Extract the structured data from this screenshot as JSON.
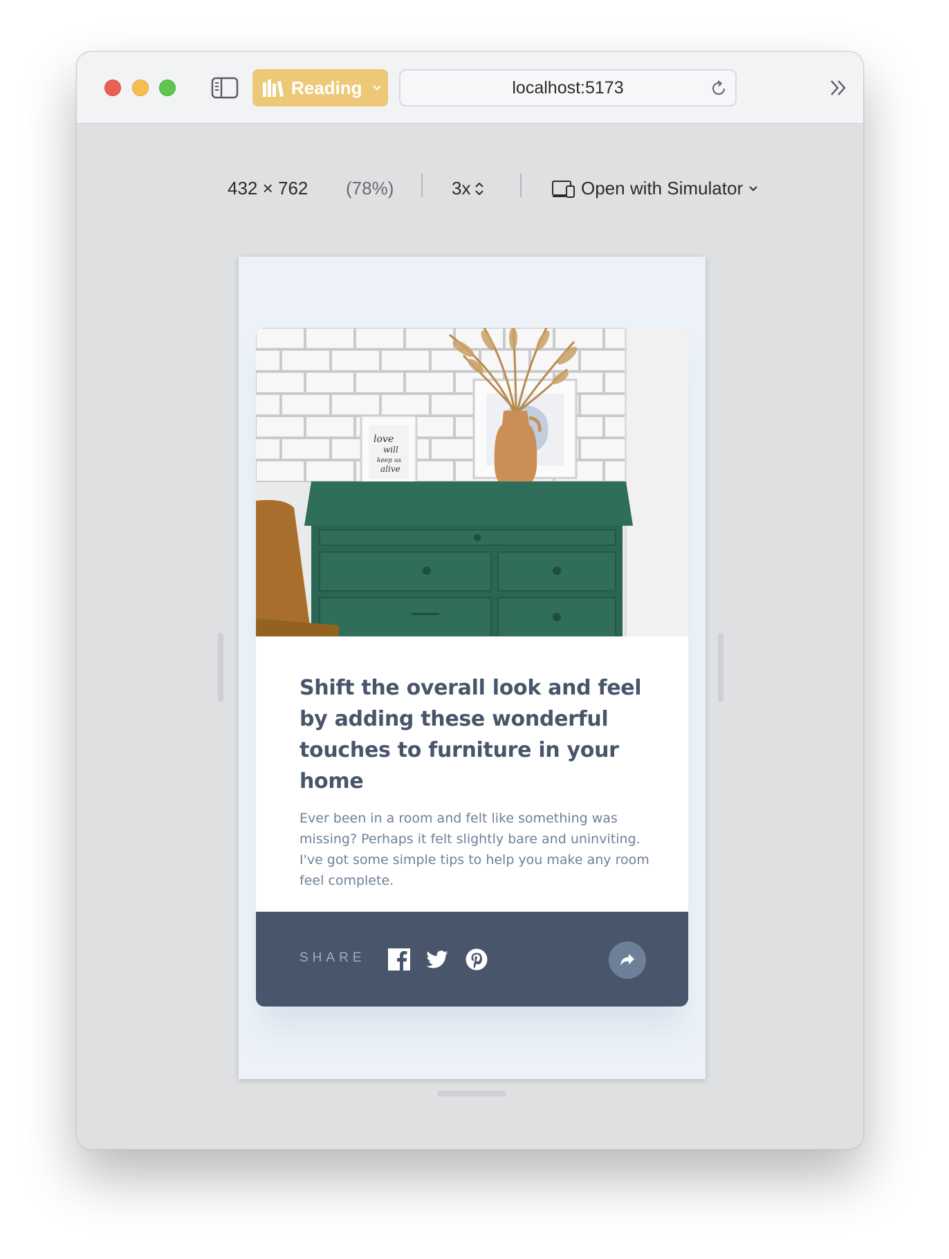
{
  "browser": {
    "reading_label": "Reading",
    "url": "localhost:5173"
  },
  "device_toolbar": {
    "dimensions": "432 × 762",
    "zoom": "(78%)",
    "scale": "3x",
    "simulator_label": "Open with Simulator"
  },
  "article": {
    "title": "Shift the overall look and feel by adding these wonderful touches to furniture in your home",
    "description": "Ever been in a room and felt like something was missing? Perhaps it felt slightly bare and uninviting. I've got some simple tips to help you make any room feel complete.",
    "share_label": "SHARE"
  },
  "icons": {
    "window_controls": [
      "close-icon",
      "minimize-icon",
      "zoom-icon"
    ],
    "toolbar": [
      "sidebar-icon",
      "books-icon",
      "chevron-down-icon",
      "reload-icon",
      "double-chevron-right-icon"
    ],
    "device": [
      "chevron-updown-icon",
      "device-icon",
      "chevron-down-icon"
    ],
    "social": [
      "facebook-icon",
      "twitter-icon",
      "pinterest-icon"
    ],
    "share": "share-arrow-icon"
  },
  "colors": {
    "reading_accent": "#edc977",
    "card_title": "#48556a",
    "card_text": "#6e8098",
    "share_bar": "#48556a",
    "share_label": "#9eafc2",
    "share_button": "#6e8098",
    "page_background": "#ecf2f8"
  }
}
